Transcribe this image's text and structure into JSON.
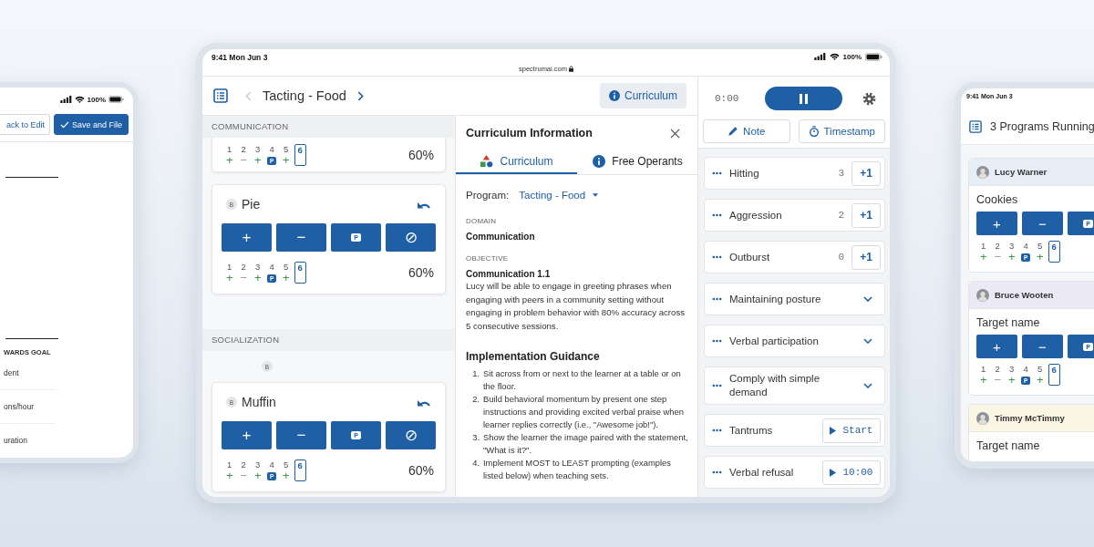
{
  "left_tablet": {
    "status": {
      "battery": "100%"
    },
    "buttons": [
      {
        "kind": "outline",
        "label": "ack to Edit"
      },
      {
        "kind": "primary",
        "label": "Save and File"
      }
    ],
    "goal_header": "WARDS GOAL",
    "rows": [
      "dent",
      "ons/hour",
      "uration"
    ]
  },
  "main_tablet": {
    "status": {
      "time": "9:41 Mon Jun 3",
      "url": "spectrumai.com",
      "battery": "100%"
    },
    "header": {
      "title": "Tacting - Food",
      "curriculum_button": "Curriculum"
    },
    "sections": [
      {
        "title": "COMMUNICATION",
        "cards": [
          {
            "trials": [
              {
                "number": "1",
                "kind": "plus",
                "mark": "+",
                "selected": false
              },
              {
                "number": "2",
                "kind": "minus",
                "mark": "−",
                "selected": false
              },
              {
                "number": "3",
                "kind": "plus",
                "mark": "+",
                "selected": false
              },
              {
                "number": "4",
                "kind": "prompt",
                "mark": "P",
                "selected": false
              },
              {
                "number": "5",
                "kind": "plus",
                "mark": "+",
                "selected": false
              },
              {
                "number": "6",
                "kind": "current",
                "selected": true
              }
            ],
            "percent": "60%"
          },
          {
            "badge": "B",
            "name": "Pie",
            "buttons": [
              {
                "kind": "plus",
                "label": "+"
              },
              {
                "kind": "minus",
                "label": "−"
              },
              {
                "kind": "prompt",
                "label": "P"
              },
              {
                "kind": "none",
                "label": "⊘"
              }
            ],
            "trials": [
              {
                "number": "1",
                "kind": "plus",
                "mark": "+",
                "selected": false
              },
              {
                "number": "2",
                "kind": "minus",
                "mark": "−",
                "selected": false
              },
              {
                "number": "3",
                "kind": "plus",
                "mark": "+",
                "selected": false
              },
              {
                "number": "4",
                "kind": "prompt",
                "mark": "P",
                "selected": false
              },
              {
                "number": "5",
                "kind": "plus",
                "mark": "+",
                "selected": false
              },
              {
                "number": "6",
                "kind": "current",
                "selected": true
              }
            ],
            "percent": "60%"
          }
        ]
      },
      {
        "title": "SOCIALIZATION",
        "badge": "B",
        "cards": [
          {
            "badge": "B",
            "name": "Muffin",
            "buttons": [
              {
                "kind": "plus",
                "label": "+"
              },
              {
                "kind": "minus",
                "label": "−"
              },
              {
                "kind": "prompt",
                "label": "P"
              },
              {
                "kind": "none",
                "label": "⊘"
              }
            ],
            "trials": [
              {
                "number": "1",
                "kind": "plus",
                "mark": "+",
                "selected": false
              },
              {
                "number": "2",
                "kind": "minus",
                "mark": "−",
                "selected": false
              },
              {
                "number": "3",
                "kind": "plus",
                "mark": "+",
                "selected": false
              },
              {
                "number": "4",
                "kind": "prompt",
                "mark": "P",
                "selected": false
              },
              {
                "number": "5",
                "kind": "plus",
                "mark": "+",
                "selected": false
              },
              {
                "number": "6",
                "kind": "current",
                "selected": true
              }
            ],
            "percent": "60%"
          }
        ]
      }
    ],
    "info_panel": {
      "title": "Curriculum Information",
      "tabs": [
        {
          "label": "Curriculum",
          "selected": true
        },
        {
          "label": "Free Operants",
          "selected": false
        }
      ],
      "program_label": "Program:",
      "program_value": "Tacting - Food",
      "fields": [
        {
          "label": "DOMAIN",
          "value": "Communication"
        },
        {
          "label": "OBJECTIVE",
          "value": "Communication 1.1",
          "text": "Lucy will be able to engage in greeting phrases when engaging with peers in a community setting without engaging in problem behavior with 80% accuracy across 5 consecutive sessions."
        }
      ],
      "guidance_title": "Implementation Guidance",
      "guidance": [
        {
          "number": "1.",
          "text": "Sit across from or next to the learner at a table or on the floor."
        },
        {
          "number": "2.",
          "text": "Build behavioral momentum by present one step instructions and providing excited verbal praise when learner replies correctly (i.e., \"Awesome job!\")."
        },
        {
          "number": "3.",
          "text": "Show the learner the image paired with the statement, \"What is it?\"."
        },
        {
          "number": "4.",
          "text": "Implement MOST to LEAST prompting (examples listed below) when teaching sets."
        }
      ]
    },
    "timer_panel": {
      "time": "0:00",
      "actions": [
        {
          "kind": "note",
          "label": "Note"
        },
        {
          "kind": "timestamp",
          "label": "Timestamp"
        }
      ],
      "behaviors": [
        {
          "kind": "count",
          "name": "Hitting",
          "count": "3",
          "button": "+1"
        },
        {
          "kind": "count",
          "name": "Aggression",
          "count": "2",
          "button": "+1"
        },
        {
          "kind": "count",
          "name": "Outburst",
          "count": "0",
          "button": "+1"
        },
        {
          "kind": "expand",
          "name": "Maintaining posture"
        },
        {
          "kind": "expand",
          "name": "Verbal participation"
        },
        {
          "kind": "expand",
          "name": "Comply with simple demand"
        },
        {
          "kind": "timer",
          "name": "Tantrums",
          "button": "Start"
        },
        {
          "kind": "timer",
          "name": "Verbal refusal",
          "button": "10:00"
        }
      ]
    }
  },
  "right_tablet": {
    "status": {
      "time": "9:41 Mon Jun 3"
    },
    "title": "3 Programs Running",
    "programs": [
      {
        "learner": "Lucy Warner",
        "color": "#e7eef7",
        "target": "Cookies",
        "buttons": [
          {
            "kind": "plus",
            "label": "+"
          },
          {
            "kind": "minus",
            "label": "−"
          },
          {
            "kind": "prompt",
            "label": "P"
          }
        ],
        "trials": [
          {
            "number": "1",
            "kind": "plus",
            "mark": "+",
            "selected": false
          },
          {
            "number": "2",
            "kind": "minus",
            "mark": "−",
            "selected": false
          },
          {
            "number": "3",
            "kind": "plus",
            "mark": "+",
            "selected": false
          },
          {
            "number": "4",
            "kind": "prompt",
            "mark": "P",
            "selected": false
          },
          {
            "number": "5",
            "kind": "plus",
            "mark": "+",
            "selected": false
          },
          {
            "number": "6",
            "kind": "current",
            "selected": true
          }
        ]
      },
      {
        "learner": "Bruce Wooten",
        "color": "#ece9f7",
        "target": "Target name",
        "buttons": [
          {
            "kind": "plus",
            "label": "+"
          },
          {
            "kind": "minus",
            "label": "−"
          },
          {
            "kind": "prompt",
            "label": "P"
          }
        ],
        "trials": [
          {
            "number": "1",
            "kind": "plus",
            "mark": "+",
            "selected": false
          },
          {
            "number": "2",
            "kind": "minus",
            "mark": "−",
            "selected": false
          },
          {
            "number": "3",
            "kind": "plus",
            "mark": "+",
            "selected": false
          },
          {
            "number": "4",
            "kind": "prompt",
            "mark": "P",
            "selected": false
          },
          {
            "number": "5",
            "kind": "plus",
            "mark": "+",
            "selected": false
          },
          {
            "number": "6",
            "kind": "current",
            "selected": true
          }
        ]
      },
      {
        "learner": "Timmy McTimmy",
        "color": "#fbf6e4",
        "target": "Target name"
      }
    ]
  }
}
